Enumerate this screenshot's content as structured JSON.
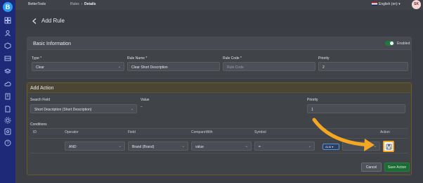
{
  "topbar": {
    "brand": "BetterTools",
    "crumbs": [
      "Rules",
      "Details"
    ],
    "language": "English (en)",
    "avatar_initials": "SK"
  },
  "header": {
    "title": "Add Rule"
  },
  "basic_info": {
    "title": "Basic Information",
    "enabled_label": "Enabled",
    "enabled": true,
    "fields": {
      "type": {
        "label": "Type *",
        "value": "Clear"
      },
      "rule_name": {
        "label": "Rule Name *",
        "value": "Clear Short Description"
      },
      "rule_code": {
        "label": "Rule Code *",
        "placeholder": "Rule Code"
      },
      "priority": {
        "label": "Priority",
        "value": "2"
      }
    }
  },
  "add_action": {
    "title": "Add Action",
    "search_field": {
      "label": "Search Field",
      "value": "Short Description (Short Description)"
    },
    "value": {
      "label": "Value",
      "value": ""
    },
    "priority": {
      "label": "Priority",
      "value": "1"
    },
    "conditions": {
      "label": "Conditions",
      "columns": [
        "ID",
        "Operator",
        "Field",
        "CompareWith",
        "Symbol",
        "",
        "Action"
      ],
      "row": {
        "operator": "AND",
        "field": "Brand (Brand)",
        "compare_with": "value",
        "symbol": "=",
        "operator_pill": "ALM"
      }
    },
    "buttons": {
      "cancel": "Cancel",
      "save": "Save Action"
    }
  },
  "colors": {
    "sidebar": "#1e2a78",
    "accent_arrow": "#f5a623",
    "save_green": "#1e6a34",
    "toggle_on": "#1f7a3c"
  }
}
